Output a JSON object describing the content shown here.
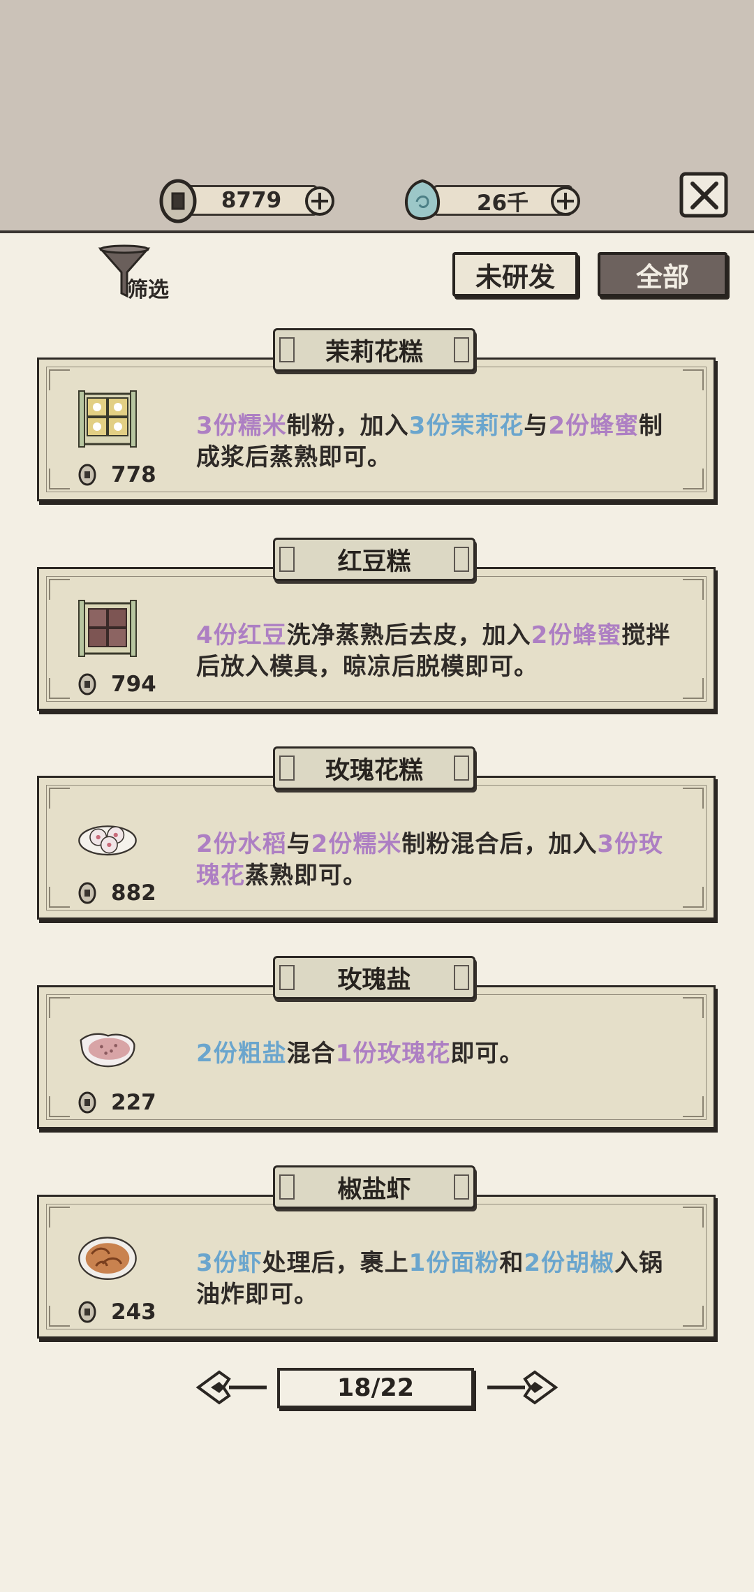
{
  "currency": {
    "coins": "8779",
    "jade": "26千"
  },
  "filter_label": "筛选",
  "tabs": {
    "unresearched": "未研发",
    "all": "全部"
  },
  "recipes": [
    {
      "name": "茉莉花糕",
      "price": "778",
      "icon": "jasmine-cake-icon",
      "segments": [
        {
          "t": "3份糯米",
          "c": "p"
        },
        {
          "t": "制粉，加入"
        },
        {
          "t": "3份茉莉花",
          "c": "b"
        },
        {
          "t": "与"
        },
        {
          "t": "2份蜂蜜",
          "c": "p"
        },
        {
          "t": "制成浆后蒸熟即可。"
        }
      ]
    },
    {
      "name": "红豆糕",
      "price": "794",
      "icon": "red-bean-cake-icon",
      "segments": [
        {
          "t": "4份红豆",
          "c": "p"
        },
        {
          "t": "洗净蒸熟后去皮，加入"
        },
        {
          "t": "2份蜂蜜",
          "c": "p"
        },
        {
          "t": "搅拌后放入模具，晾凉后脱模即可。"
        }
      ]
    },
    {
      "name": "玫瑰花糕",
      "price": "882",
      "icon": "rose-cake-icon",
      "segments": [
        {
          "t": "2份水稻",
          "c": "p"
        },
        {
          "t": "与"
        },
        {
          "t": "2份糯米",
          "c": "p"
        },
        {
          "t": "制粉混合后，加入"
        },
        {
          "t": "3份玫瑰花",
          "c": "p"
        },
        {
          "t": "蒸熟即可。"
        }
      ]
    },
    {
      "name": "玫瑰盐",
      "price": "227",
      "icon": "rose-salt-icon",
      "segments": [
        {
          "t": "2份粗盐",
          "c": "b"
        },
        {
          "t": "混合"
        },
        {
          "t": "1份玫瑰花",
          "c": "p"
        },
        {
          "t": "即可。"
        }
      ]
    },
    {
      "name": "椒盐虾",
      "price": "243",
      "icon": "salt-pepper-shrimp-icon",
      "segments": [
        {
          "t": "3份虾",
          "c": "b"
        },
        {
          "t": "处理后，裹上"
        },
        {
          "t": "1份面粉",
          "c": "b"
        },
        {
          "t": "和"
        },
        {
          "t": "2份胡椒",
          "c": "b"
        },
        {
          "t": "入锅油炸即可。"
        }
      ]
    }
  ],
  "pager": {
    "label": "18/22"
  },
  "colors": {
    "ingredient_blue": "#6aa5cd",
    "ingredient_purple": "#ad7fc3",
    "background": "#f3efe4",
    "top_band": "#cbc2b8"
  }
}
